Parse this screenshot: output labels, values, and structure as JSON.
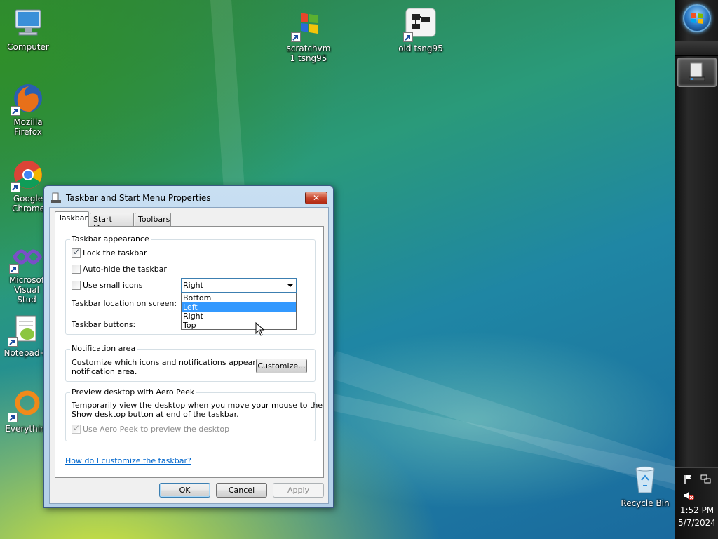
{
  "desktop": {
    "icons": [
      {
        "label": "Computer"
      },
      {
        "label": "Mozilla Firefox"
      },
      {
        "label": "Google Chrome"
      },
      {
        "label": "Microsof Visual Stud"
      },
      {
        "label": "Notepad+"
      },
      {
        "label": "Everythin"
      },
      {
        "label": "scratchvm 1 tsng95"
      },
      {
        "label": "old tsng95"
      },
      {
        "label": "Recycle Bin"
      }
    ]
  },
  "taskbar": {
    "clock_time": "1:52 PM",
    "clock_date": "5/7/2024",
    "position": "right"
  },
  "dialog": {
    "title": "Taskbar and Start Menu Properties",
    "close_label": "✕",
    "tabs": [
      {
        "label": "Taskbar",
        "active": true
      },
      {
        "label": "Start Menu",
        "active": false
      },
      {
        "label": "Toolbars",
        "active": false
      }
    ],
    "appearance": {
      "group_title": "Taskbar appearance",
      "lock_label": "Lock the taskbar",
      "lock_checked": true,
      "autohide_label": "Auto-hide the taskbar",
      "autohide_checked": false,
      "small_icons_label": "Use small icons",
      "small_icons_checked": false,
      "location_label": "Taskbar location on screen:",
      "location_value": "Right",
      "location_options": [
        "Bottom",
        "Left",
        "Right",
        "Top"
      ],
      "location_highlighted": "Left",
      "buttons_label": "Taskbar buttons:"
    },
    "notification": {
      "group_title": "Notification area",
      "text_line1": "Customize which icons and notifications appear in the",
      "text_line2": "notification area.",
      "customize_label": "Customize..."
    },
    "peek": {
      "group_title": "Preview desktop with Aero Peek",
      "text_line1": "Temporarily view the desktop when you move your mouse to the",
      "text_line2": "Show desktop button at end of the taskbar.",
      "checkbox_label": "Use Aero Peek to preview the desktop",
      "checkbox_checked": true
    },
    "help_link": "How do I customize the taskbar?",
    "ok_label": "OK",
    "cancel_label": "Cancel",
    "apply_label": "Apply"
  },
  "colors": {
    "highlight": "#3399ff",
    "link": "#0066cc",
    "close_button": "#c8452b"
  }
}
